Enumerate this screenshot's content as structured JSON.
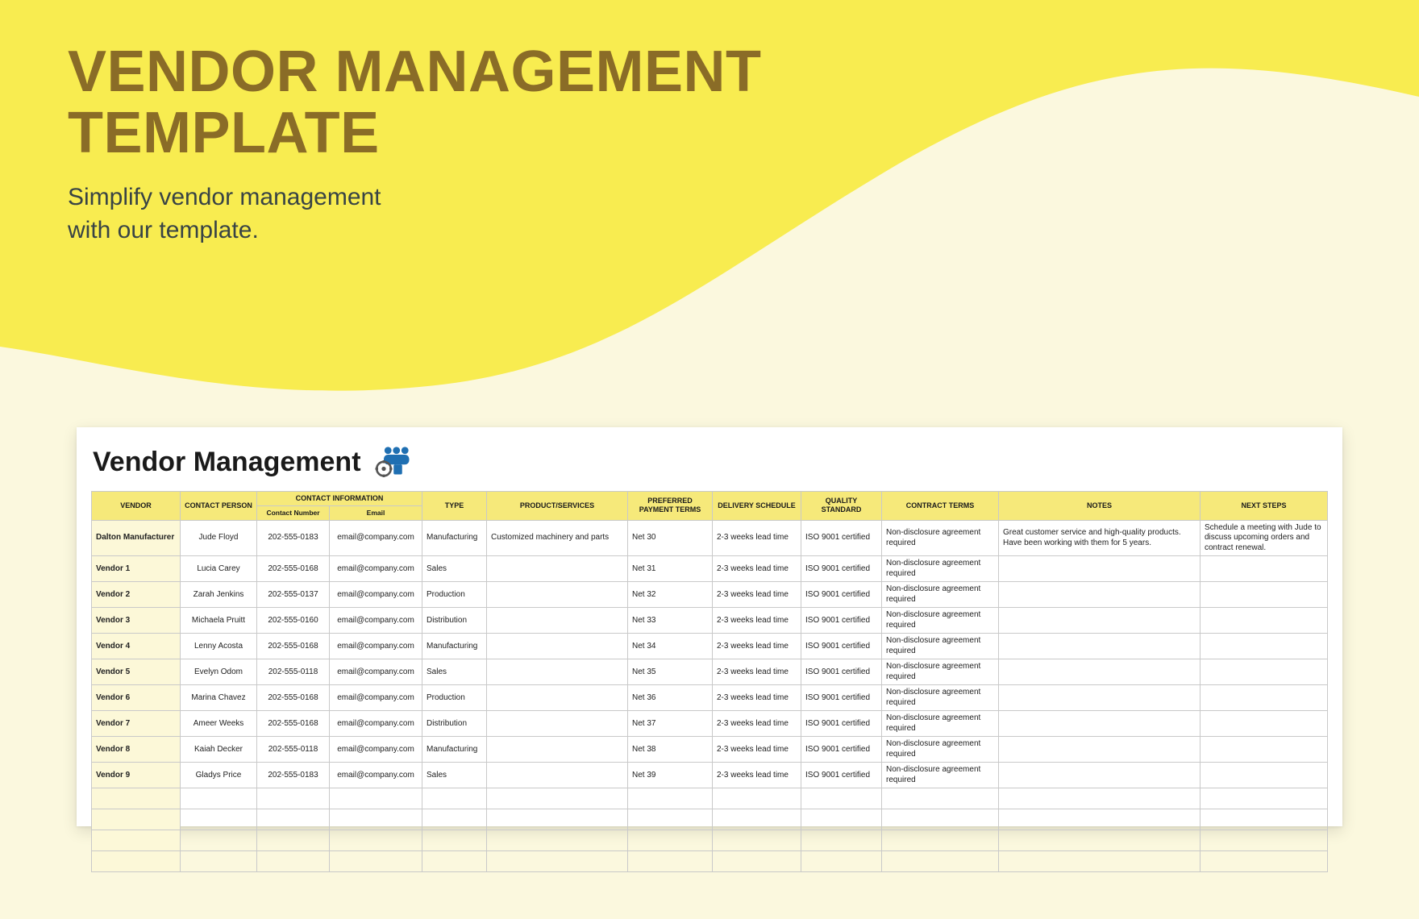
{
  "hero": {
    "title_line1": "VENDOR MANAGEMENT",
    "title_line2": "TEMPLATE",
    "subtitle_line1": "Simplify vendor management",
    "subtitle_line2": "with our template."
  },
  "sheet": {
    "title": "Vendor Management",
    "headers": {
      "vendor": "VENDOR",
      "contact_person": "CONTACT PERSON",
      "contact_information": "CONTACT INFORMATION",
      "contact_number": "Contact Number",
      "email": "Email",
      "type": "TYPE",
      "product_services": "PRODUCT/SERVICES",
      "preferred_payment_terms": "PREFERRED PAYMENT TERMS",
      "delivery_schedule": "DELIVERY SCHEDULE",
      "quality_standard": "QUALITY STANDARD",
      "contract_terms": "CONTRACT TERMS",
      "notes": "NOTES",
      "next_steps": "NEXT STEPS"
    },
    "rows": [
      {
        "vendor": "Dalton Manufacturer",
        "person": "Jude Floyd",
        "phone": "202-555-0183",
        "email": "email@company.com",
        "type": "Manufacturing",
        "product": "Customized machinery and parts",
        "payment": "Net 30",
        "delivery": "2-3 weeks lead time",
        "quality": "ISO 9001 certified",
        "contract": "Non-disclosure agreement required",
        "notes": "Great customer service and high-quality products. Have been working with them for 5 years.",
        "next": "Schedule a meeting with Jude to discuss upcoming orders and contract renewal."
      },
      {
        "vendor": "Vendor 1",
        "person": "Lucia Carey",
        "phone": "202-555-0168",
        "email": "email@company.com",
        "type": "Sales",
        "product": "",
        "payment": "Net 31",
        "delivery": "2-3 weeks lead time",
        "quality": "ISO 9001 certified",
        "contract": "Non-disclosure agreement required",
        "notes": "",
        "next": ""
      },
      {
        "vendor": "Vendor 2",
        "person": "Zarah Jenkins",
        "phone": "202-555-0137",
        "email": "email@company.com",
        "type": "Production",
        "product": "",
        "payment": "Net 32",
        "delivery": "2-3 weeks lead time",
        "quality": "ISO 9001 certified",
        "contract": "Non-disclosure agreement required",
        "notes": "",
        "next": ""
      },
      {
        "vendor": "Vendor 3",
        "person": "Michaela Pruitt",
        "phone": "202-555-0160",
        "email": "email@company.com",
        "type": "Distribution",
        "product": "",
        "payment": "Net 33",
        "delivery": "2-3 weeks lead time",
        "quality": "ISO 9001 certified",
        "contract": "Non-disclosure agreement required",
        "notes": "",
        "next": ""
      },
      {
        "vendor": "Vendor 4",
        "person": "Lenny Acosta",
        "phone": "202-555-0168",
        "email": "email@company.com",
        "type": "Manufacturing",
        "product": "",
        "payment": "Net 34",
        "delivery": "2-3 weeks lead time",
        "quality": "ISO 9001 certified",
        "contract": "Non-disclosure agreement required",
        "notes": "",
        "next": ""
      },
      {
        "vendor": "Vendor 5",
        "person": "Evelyn Odom",
        "phone": "202-555-0118",
        "email": "email@company.com",
        "type": "Sales",
        "product": "",
        "payment": "Net 35",
        "delivery": "2-3 weeks lead time",
        "quality": "ISO 9001 certified",
        "contract": "Non-disclosure agreement required",
        "notes": "",
        "next": ""
      },
      {
        "vendor": "Vendor 6",
        "person": "Marina Chavez",
        "phone": "202-555-0168",
        "email": "email@company.com",
        "type": "Production",
        "product": "",
        "payment": "Net 36",
        "delivery": "2-3 weeks lead time",
        "quality": "ISO 9001 certified",
        "contract": "Non-disclosure agreement required",
        "notes": "",
        "next": ""
      },
      {
        "vendor": "Vendor 7",
        "person": "Ameer Weeks",
        "phone": "202-555-0168",
        "email": "email@company.com",
        "type": "Distribution",
        "product": "",
        "payment": "Net 37",
        "delivery": "2-3 weeks lead time",
        "quality": "ISO 9001 certified",
        "contract": "Non-disclosure agreement required",
        "notes": "",
        "next": ""
      },
      {
        "vendor": "Vendor 8",
        "person": "Kaiah Decker",
        "phone": "202-555-0118",
        "email": "email@company.com",
        "type": "Manufacturing",
        "product": "",
        "payment": "Net 38",
        "delivery": "2-3 weeks lead time",
        "quality": "ISO 9001 certified",
        "contract": "Non-disclosure agreement required",
        "notes": "",
        "next": ""
      },
      {
        "vendor": "Vendor 9",
        "person": "Gladys Price",
        "phone": "202-555-0183",
        "email": "email@company.com",
        "type": "Sales",
        "product": "",
        "payment": "Net 39",
        "delivery": "2-3 weeks lead time",
        "quality": "ISO 9001 certified",
        "contract": "Non-disclosure agreement required",
        "notes": "",
        "next": ""
      }
    ],
    "empty_rows": 4
  },
  "colors": {
    "wave": "#f8ec50",
    "canvas": "#fbf8de",
    "heading": "#8a6c27",
    "table_header": "#f6e97a",
    "vendor_col": "#fcf8d8"
  }
}
